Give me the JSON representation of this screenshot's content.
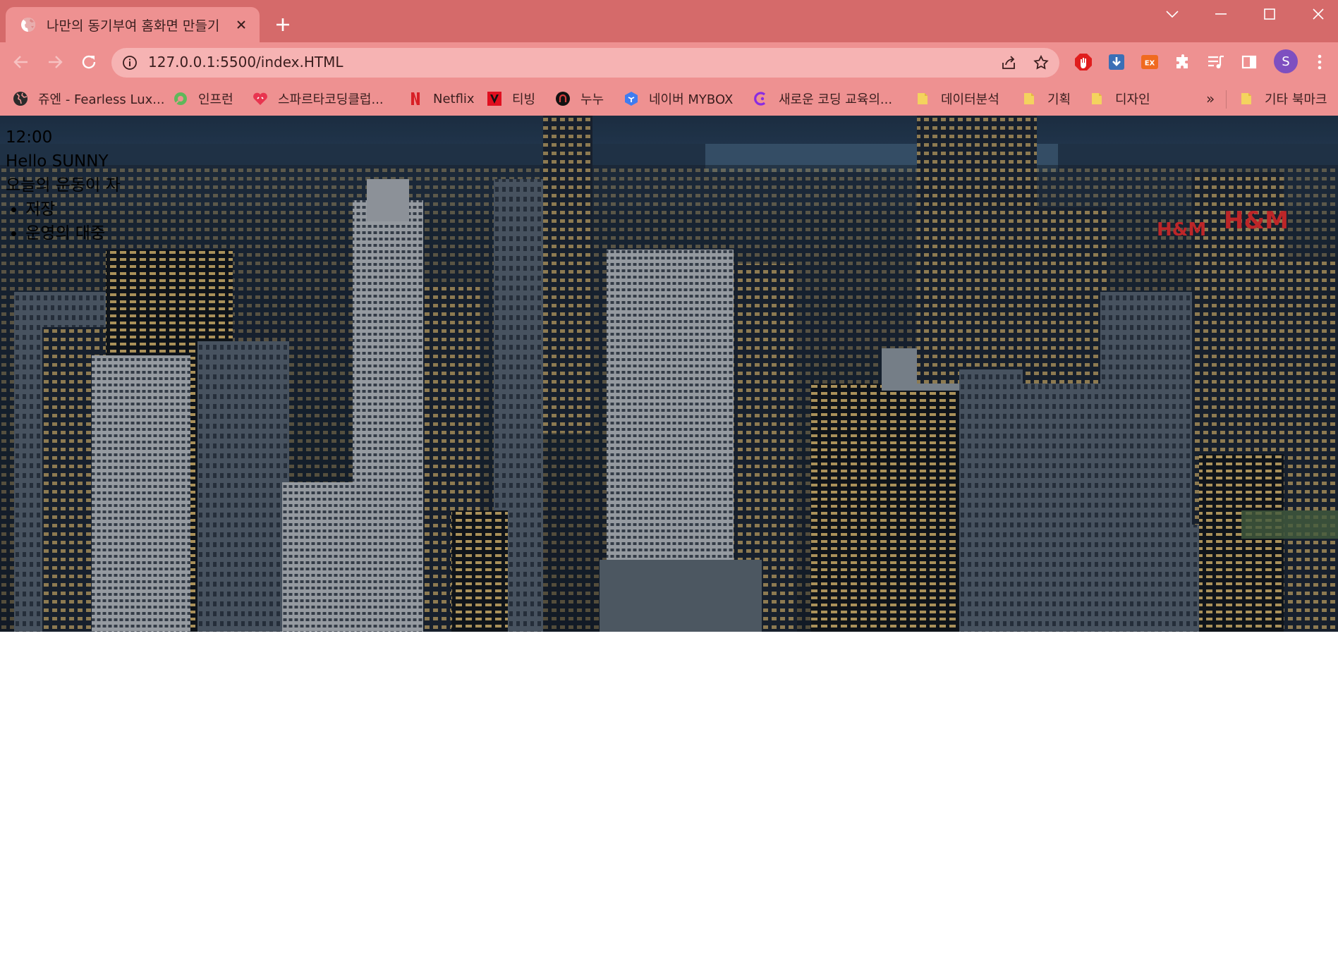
{
  "tab": {
    "title": "나만의 동기부여 홈화면 만들기"
  },
  "address": {
    "url": "127.0.0.1:5500/index.HTML"
  },
  "avatar": {
    "initial": "S"
  },
  "bookmarks": [
    {
      "label": "쥬엔 - Fearless Lux...",
      "icon": "globe-icon"
    },
    {
      "label": "인프런",
      "icon": "inflearn-icon"
    },
    {
      "label": "스파르타코딩클럽...",
      "icon": "sparta-icon"
    },
    {
      "label": "Netflix",
      "icon": "netflix-icon"
    },
    {
      "label": "티빙",
      "icon": "tving-icon"
    },
    {
      "label": "누누",
      "icon": "nunu-icon"
    },
    {
      "label": "네이버 MYBOX",
      "icon": "mybox-icon"
    },
    {
      "label": "새로운 코딩 교육의...",
      "icon": "coding-icon"
    },
    {
      "label": "데이터분석",
      "icon": "folder-icon"
    },
    {
      "label": "기획",
      "icon": "folder-icon"
    },
    {
      "label": "디자인",
      "icon": "folder-icon"
    }
  ],
  "overflow": {
    "label": "»"
  },
  "other_bookmarks": {
    "label": "기타 북마크"
  },
  "page": {
    "clock": "12:00",
    "greeting": "Hello SUNNY",
    "motto": "오늘의 운동이 자",
    "list": [
      "저장",
      "운영의 대중"
    ]
  },
  "colors": {
    "tabstrip": "#d56a6a",
    "toolbar": "#ee9191",
    "omnibox": "#f6b3b3",
    "avatar": "#7e4fc0"
  }
}
